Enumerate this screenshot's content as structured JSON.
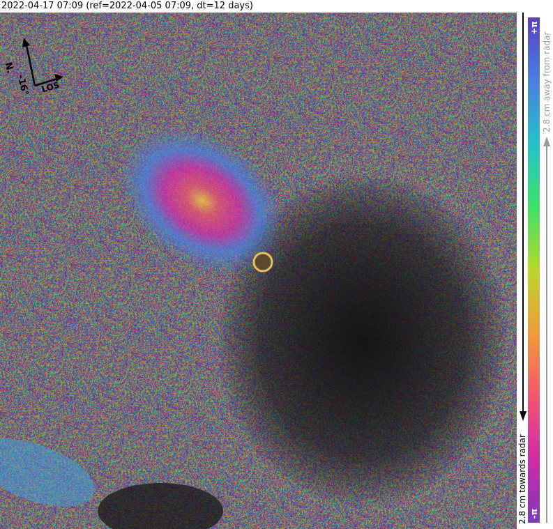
{
  "header": {
    "title": "2022-04-17 07:09 (ref=2022-04-05 07:09, dt=12 days)"
  },
  "compass": {
    "north_label": "N.",
    "heading_label": "-16°",
    "los_label": "LOS"
  },
  "colorbar": {
    "top_label": "+π",
    "bottom_label": "-π",
    "away_label": "2.8 cm away from radar",
    "towards_label": "2.8 cm towards radar",
    "colors": [
      "#5a3fc0",
      "#4a7fe0",
      "#27c0c8",
      "#3ee06a",
      "#b8d82e",
      "#f09a3a",
      "#f2566e",
      "#d02aa8",
      "#7a3ab8"
    ]
  }
}
